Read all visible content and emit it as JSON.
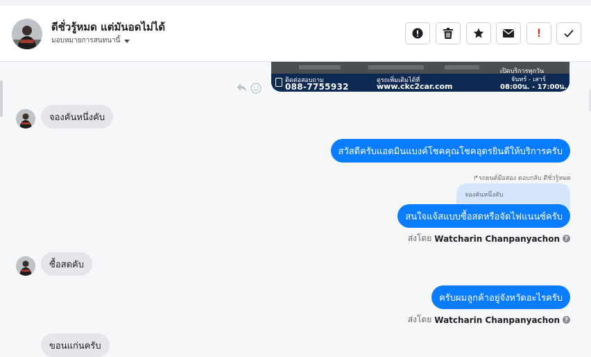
{
  "header": {
    "name": "ดีชั่วรู้หมด แต่มันอดไม่ได้",
    "assign_label": "มอบหมายการสนทนานี้"
  },
  "actions": {
    "important_label": "!"
  },
  "banner": {
    "contact_label": "ติดต่อสอบถาม",
    "phone": "088-7755932",
    "more_label": "ดูรถเพิ่มเติมได้ที่",
    "website": "www.ckc2car.com",
    "open_label": "เปิดบริการทุกวัน",
    "days": "จันทร์ - เสาร์",
    "hours": "08:00น. - 17:00น."
  },
  "messages": {
    "m1": "จองคันหนึ่งคับ",
    "m2": "สวัสดีครับแอดมินแบงค์โชคคุณโชคอุดรยินดีให้บริการครับ",
    "quote_meta": "รถยนต์มือสอง ตอบกลับ ดีชั่วรู้หมด",
    "quote_text": "จองคันหนึ่งคับ",
    "m3": "สนใจแจ้สแบบซื้อสดหรือจัดไฟแนนซ์ครับ",
    "m4": "ซื้อสดคับ",
    "m5": "ครับผมลูกค้าอยู่จังหวัดอะไรครับ",
    "m6": "ขอนแก่นครับ"
  },
  "sent_by": {
    "prefix": "ส่งโดย",
    "name": "Watcharin Chanpanyachon",
    "help": "?"
  },
  "colors": {
    "outgoing": "#0a7cff",
    "incoming": "#e4e6eb",
    "important": "#e0241b"
  }
}
